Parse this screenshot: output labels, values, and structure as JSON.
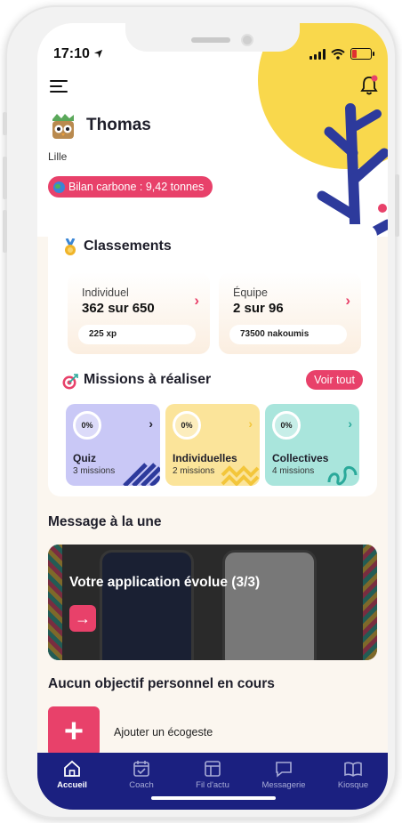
{
  "status": {
    "time": "17:10"
  },
  "user": {
    "name": "Thomas",
    "city": "Lille",
    "carbon_badge": "Bilan carbone : 9,42 tonnes"
  },
  "rankings": {
    "title": "Classements",
    "individual": {
      "label": "Individuel",
      "value": "362 sur 650",
      "pill": "225 xp"
    },
    "team": {
      "label": "Équipe",
      "value": "2 sur 96",
      "pill": "73500 nakoumis"
    }
  },
  "missions": {
    "title": "Missions à réaliser",
    "see_all": "Voir tout",
    "items": [
      {
        "progress": "0%",
        "title": "Quiz",
        "subtitle": "3 missions",
        "color": "#c9c8f6",
        "chevron_color": "#1e1e2a"
      },
      {
        "progress": "0%",
        "title": "Individuelles",
        "subtitle": "2 missions",
        "color": "#fbe49a",
        "chevron_color": "#f3c63b"
      },
      {
        "progress": "0%",
        "title": "Collectives",
        "subtitle": "4 missions",
        "color": "#a9e5dc",
        "chevron_color": "#2aa99a"
      }
    ]
  },
  "featured": {
    "heading": "Message à la une",
    "banner_title": "Votre application évolue (3/3)"
  },
  "objectives": {
    "heading": "Aucun objectif personnel en cours",
    "add_label": "Ajouter un écogeste"
  },
  "tabbar": {
    "items": [
      {
        "label": "Accueil",
        "icon": "home-icon",
        "active": true
      },
      {
        "label": "Coach",
        "icon": "calendar-check-icon",
        "active": false
      },
      {
        "label": "Fil d'actu",
        "icon": "news-icon",
        "active": false
      },
      {
        "label": "Messagerie",
        "icon": "chat-icon",
        "active": false
      },
      {
        "label": "Kiosque",
        "icon": "book-icon",
        "active": false
      }
    ]
  },
  "colors": {
    "accent": "#e8416a",
    "navy": "#1b2080",
    "sun": "#f9d84c",
    "plant": "#2d3a9c"
  }
}
